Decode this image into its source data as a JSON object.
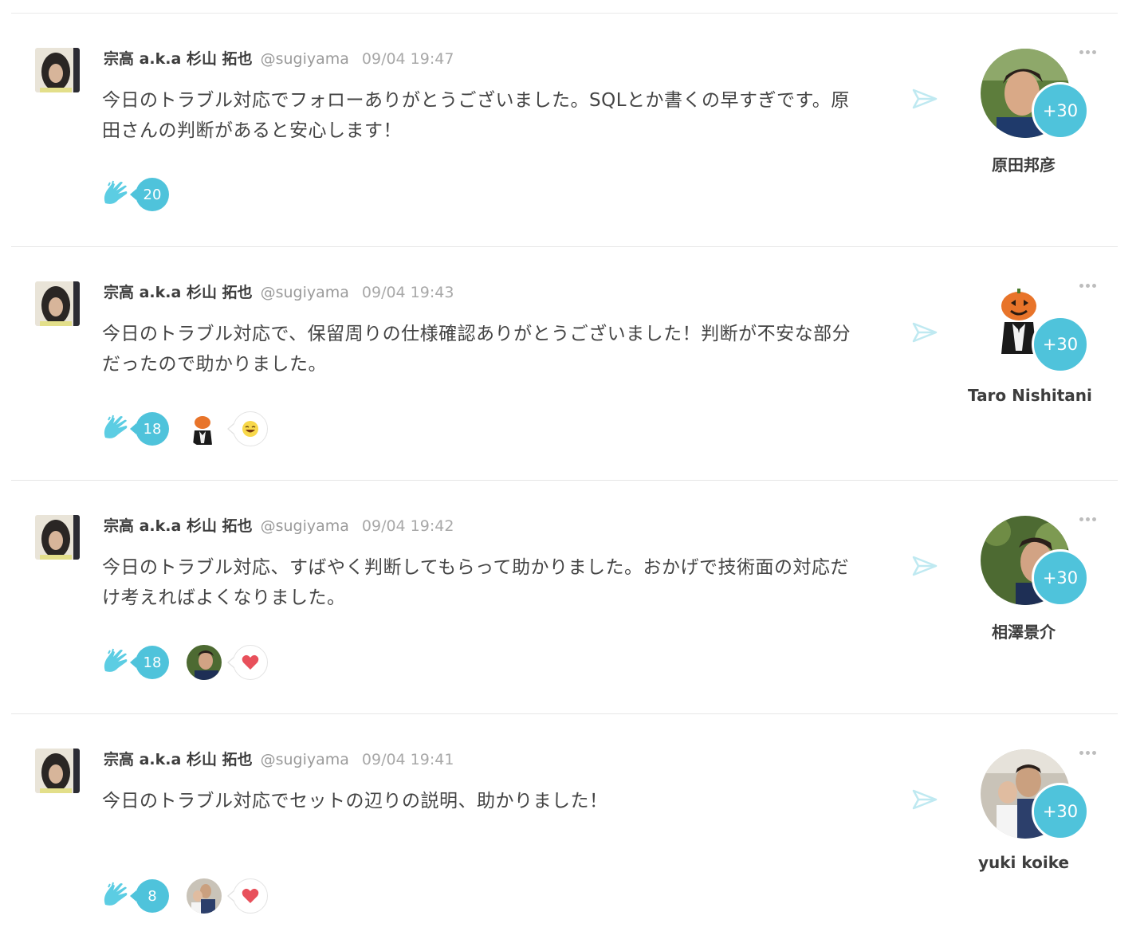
{
  "theme": {
    "accent": "#4fc3db",
    "heart": "#e8505b",
    "emoji_yellow": "#f8d84a"
  },
  "posts": [
    {
      "author": "宗高 a.k.a 杉山 拓也",
      "handle": "@sugiyama",
      "time": "09/04 19:47",
      "line1": "今日のトラブル対応でフォローありがとうございました。SQLとか書くの早すぎです。原",
      "line2": "田さんの判断があると安心します！",
      "clap_count": "20",
      "recipient": "原田邦彦",
      "plus": "+30",
      "reactions": []
    },
    {
      "author": "宗高 a.k.a 杉山 拓也",
      "handle": "@sugiyama",
      "time": "09/04 19:43",
      "line1": "今日のトラブル対応で、保留周りの仕様確認ありがとうございました！判断が不安な部分",
      "line2": "だったので助かりました。",
      "clap_count": "18",
      "recipient": "Taro Nishitani",
      "plus": "+30",
      "reactions": [
        "laughing-emoji-icon"
      ]
    },
    {
      "author": "宗高 a.k.a 杉山 拓也",
      "handle": "@sugiyama",
      "time": "09/04 19:42",
      "line1": "今日のトラブル対応、すばやく判断してもらって助かりました。おかげで技術面の対応だ",
      "line2": "け考えればよくなりました。",
      "clap_count": "18",
      "recipient": "相澤景介",
      "plus": "+30",
      "reactions": [
        "heart-icon"
      ]
    },
    {
      "author": "宗高 a.k.a 杉山 拓也",
      "handle": "@sugiyama",
      "time": "09/04 19:41",
      "line1": "今日のトラブル対応でセットの辺りの説明、助かりました！",
      "line2": "",
      "clap_count": "8",
      "recipient": "yuki koike",
      "plus": "+30",
      "reactions": [
        "heart-icon"
      ]
    }
  ]
}
